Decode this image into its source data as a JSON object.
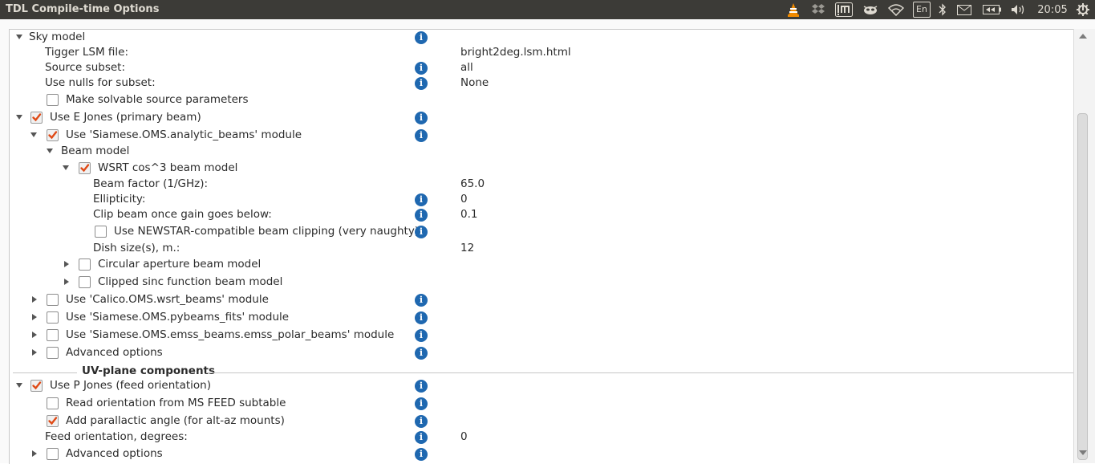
{
  "window": {
    "title": "TDL Compile-time Options"
  },
  "tray": {
    "keyboard_layout": "En",
    "clock": "20:05",
    "icons": [
      "vlc-icon",
      "dropbox-icon",
      "im-icon",
      "mail-indicator-icon",
      "wifi-icon",
      "keyboard-icon",
      "bluetooth-icon",
      "mail-icon",
      "battery-icon",
      "volume-icon",
      "settings-gear-icon"
    ]
  },
  "colors": {
    "panel_bg": "#3c3b37",
    "checkbox_tick": "#df4a16",
    "info_icon": "#1f68b0"
  },
  "tree": {
    "rows": [
      {
        "label": "Sky model",
        "value": "",
        "expander": "down",
        "checkbox": null,
        "info": true
      },
      {
        "label": "Tigger LSM file:",
        "value": "bright2deg.lsm.html",
        "expander": null,
        "checkbox": null,
        "info": false
      },
      {
        "label": "Source subset:",
        "value": "all",
        "expander": null,
        "checkbox": null,
        "info": true
      },
      {
        "label": "Use nulls for subset:",
        "value": "None",
        "expander": null,
        "checkbox": null,
        "info": true
      },
      {
        "label": "Make solvable source parameters",
        "value": "",
        "expander": null,
        "checkbox": false,
        "info": false
      },
      {
        "label": "Use E Jones (primary beam)",
        "value": "",
        "expander": "down",
        "checkbox": true,
        "info": true
      },
      {
        "label": "Use 'Siamese.OMS.analytic_beams' module",
        "value": "",
        "expander": "down",
        "checkbox": true,
        "info": true
      },
      {
        "label": "Beam model",
        "value": "",
        "expander": "down",
        "checkbox": null,
        "info": false
      },
      {
        "label": "WSRT cos^3 beam model",
        "value": "",
        "expander": "down",
        "checkbox": true,
        "info": false
      },
      {
        "label": "Beam factor (1/GHz):",
        "value": "65.0",
        "expander": null,
        "checkbox": null,
        "info": false
      },
      {
        "label": "Ellipticity:",
        "value": "0",
        "expander": null,
        "checkbox": null,
        "info": true
      },
      {
        "label": "Clip beam once gain goes below:",
        "value": "0.1",
        "expander": null,
        "checkbox": null,
        "info": true
      },
      {
        "label": "Use NEWSTAR-compatible beam clipping (very naughty)",
        "value": "",
        "expander": null,
        "checkbox": false,
        "info": true
      },
      {
        "label": "Dish size(s), m.:",
        "value": "12",
        "expander": null,
        "checkbox": null,
        "info": false
      },
      {
        "label": "Circular aperture beam model",
        "value": "",
        "expander": "right",
        "checkbox": false,
        "info": false
      },
      {
        "label": "Clipped sinc function beam model",
        "value": "",
        "expander": "right",
        "checkbox": false,
        "info": false
      },
      {
        "label": "Use 'Calico.OMS.wsrt_beams' module",
        "value": "",
        "expander": "right",
        "checkbox": false,
        "info": true
      },
      {
        "label": "Use 'Siamese.OMS.pybeams_fits' module",
        "value": "",
        "expander": "right",
        "checkbox": false,
        "info": true
      },
      {
        "label": "Use 'Siamese.OMS.emss_beams.emss_polar_beams' module",
        "value": "",
        "expander": "right",
        "checkbox": false,
        "info": true
      },
      {
        "label": "Advanced options",
        "value": "",
        "expander": "right",
        "checkbox": false,
        "info": true
      },
      {
        "label": "Use P Jones (feed orientation)",
        "value": "",
        "expander": "down",
        "checkbox": true,
        "info": true
      },
      {
        "label": "Read orientation from MS FEED subtable",
        "value": "",
        "expander": null,
        "checkbox": false,
        "info": true
      },
      {
        "label": "Add parallactic angle (for alt-az mounts)",
        "value": "",
        "expander": null,
        "checkbox": true,
        "info": true
      },
      {
        "label": "Feed orientation, degrees:",
        "value": "0",
        "expander": null,
        "checkbox": null,
        "info": true
      },
      {
        "label": "Advanced options",
        "value": "",
        "expander": "right",
        "checkbox": false,
        "info": true
      }
    ],
    "section_title": "UV-plane components"
  }
}
